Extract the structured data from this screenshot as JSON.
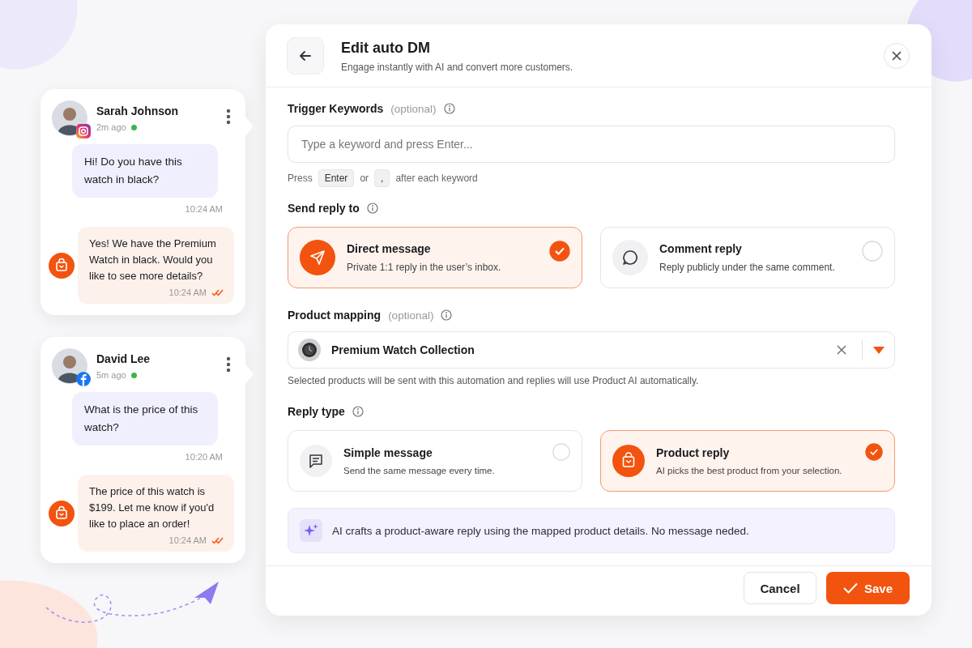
{
  "conversations": [
    {
      "name": "Sarah Johnson",
      "time": "2m ago",
      "online": true,
      "kind": "instagram",
      "messages": [
        {
          "kind": "incoming",
          "text": "Hi! Do you have this watch in black?",
          "time": "10:24 AM"
        },
        {
          "kind": "outgoing",
          "text": "Yes! We have the Premium Watch in black. Would you like to see more details?",
          "time": "10:24 AM",
          "read": true
        }
      ]
    },
    {
      "name": "David Lee",
      "time": "5m ago",
      "online": true,
      "kind": "facebook",
      "messages": [
        {
          "kind": "incoming",
          "text": "What is the price of this watch?",
          "time": "10:20 AM"
        },
        {
          "kind": "outgoing",
          "text": "The price of this watch is $199. Let me know if you'd like to place an order!",
          "time": "10:24 AM",
          "read": true
        }
      ]
    }
  ],
  "modal": {
    "title": "Edit auto DM",
    "subtitle": "Engage instantly with AI and convert more customers.",
    "keywords": {
      "label": "Trigger Keywords",
      "optional": "(optional)",
      "placeholder": "Type a keyword and press Enter...",
      "hint": [
        "Press",
        "Enter",
        "or",
        ",",
        "after each keyword"
      ]
    },
    "send_reply_to": {
      "label": "Send reply to",
      "options": [
        {
          "kind": "direct",
          "title": "Direct message",
          "description": "Private 1:1 reply in the user’s inbox.",
          "selected": true
        },
        {
          "kind": "comment",
          "title": "Comment reply",
          "description": "Reply publicly under the same comment.",
          "selected": false
        }
      ]
    },
    "product_mapping": {
      "label": "Product mapping",
      "optional": "(optional)",
      "value": "Premium Watch Collection",
      "note": "Selected products will be sent with this automation and replies will use Product AI automatically."
    },
    "reply_type": {
      "label": "Reply type",
      "options": [
        {
          "kind": "simple",
          "title": "Simple message",
          "description": "Send the same message every time.",
          "selected": false
        },
        {
          "kind": "product",
          "title": "Product reply",
          "description": "AI picks the best product from your selection.",
          "selected": true
        }
      ]
    },
    "ai_note": "AI crafts a product-aware reply using the mapped product details. No message neded.",
    "buttons": [
      {
        "kind": "secondary",
        "label": "Cancel"
      },
      {
        "kind": "primary",
        "label": "Save"
      }
    ]
  }
}
